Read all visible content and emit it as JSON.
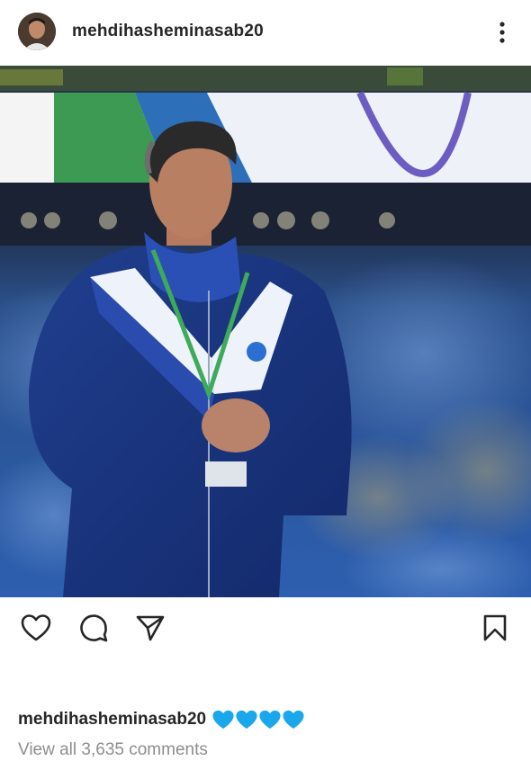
{
  "post": {
    "username": "mehdihasheminasab20",
    "caption_user": "mehdihasheminasab20",
    "caption_hearts": 4,
    "view_comments": "View all 3,635 comments"
  },
  "icons": {
    "more": "more-vertical-icon",
    "like": "heart-icon",
    "comment": "comment-icon",
    "share": "send-icon",
    "save": "bookmark-icon",
    "caption_emoji": "blue-heart-icon"
  },
  "colors": {
    "text": "#262626",
    "muted": "#8e8e8e",
    "heart_blue": "#1aa7ec",
    "jacket_blue": "#1c3e96"
  }
}
